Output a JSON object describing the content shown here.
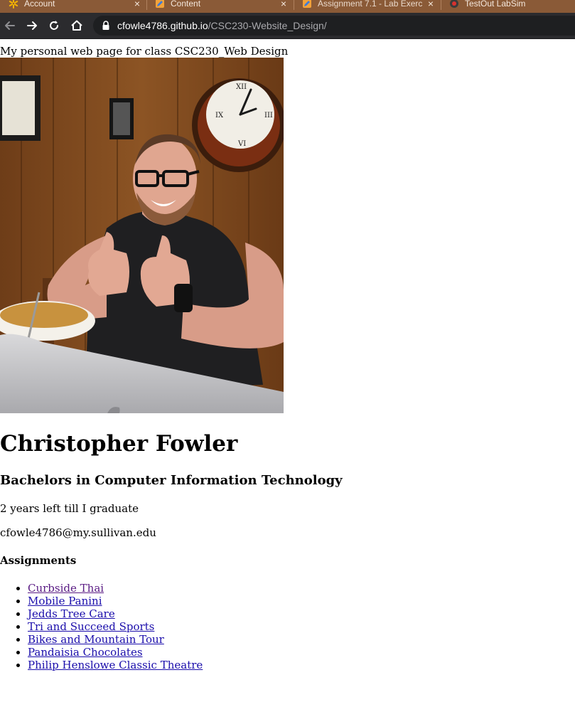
{
  "browser": {
    "tabs": [
      {
        "label": "Account",
        "icon": "walmart-spark-icon"
      },
      {
        "label": "Content",
        "icon": "pencil-doc-icon"
      },
      {
        "label": "Assignment 7.1 - Lab Exerc",
        "icon": "pencil-doc-icon"
      },
      {
        "label": "TestOut LabSim",
        "icon": "testout-icon"
      }
    ],
    "close_glyph": "×",
    "url_host": "cfowle4786.github.io",
    "url_path": "/CSC230-Website_Design/",
    "chrome_color": "#8a5a37"
  },
  "page": {
    "tagline": "My personal web page for class CSC230_Web Design",
    "photo_alt": "Christopher Fowler",
    "name": "Christopher Fowler",
    "degree": "Bachelors in Computer Information Technology",
    "years_left": "2 years left till I graduate",
    "email": "cfowle4786@my.sullivan.edu",
    "assignments_heading": "Assignments",
    "assignments": [
      {
        "label": "Curbside Thai",
        "visited": true
      },
      {
        "label": "Mobile Panini",
        "visited": false
      },
      {
        "label": "Jedds Tree Care",
        "visited": false
      },
      {
        "label": "Tri and Succeed Sports",
        "visited": false
      },
      {
        "label": "Bikes and Mountain Tour",
        "visited": false
      },
      {
        "label": "Pandaisia Chocolates",
        "visited": false
      },
      {
        "label": "Philip Henslowe Classic Theatre",
        "visited": false
      }
    ],
    "link_color": "#1a0dab",
    "visited_link_color": "#5a1b84"
  }
}
